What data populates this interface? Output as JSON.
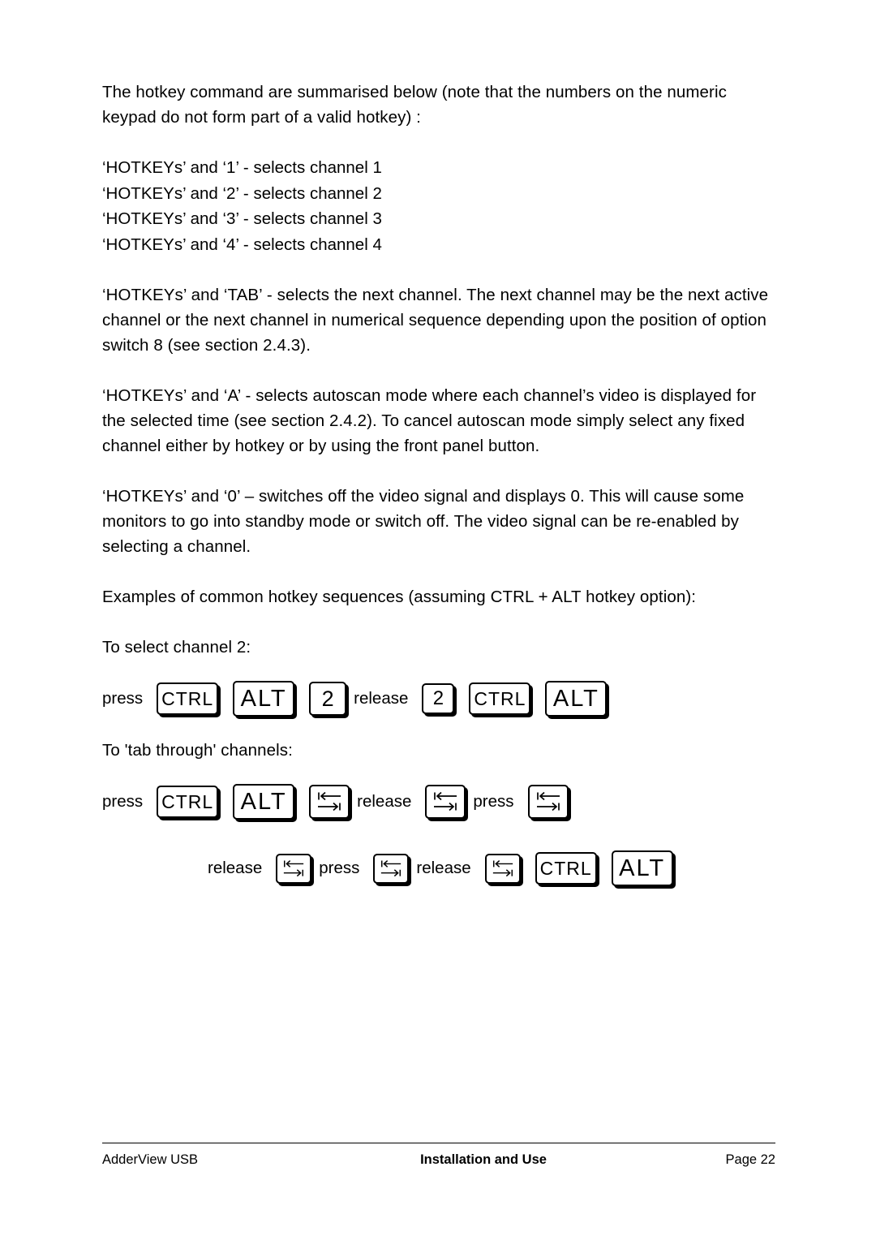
{
  "document": {
    "intro": "The hotkey command are summarised below (note that the numbers on the numeric keypad do not form part of a valid hotkey) :",
    "hotkey_list": [
      "‘HOTKEYs’ and ‘1’ - selects channel 1",
      "‘HOTKEYs’ and ‘2’ - selects channel 2",
      "‘HOTKEYs’ and ‘3’ - selects channel 3",
      "‘HOTKEYs’ and ‘4’ - selects channel 4"
    ],
    "para_tab": "‘HOTKEYs’ and ‘TAB’ - selects the next channel. The next channel may be the next active channel or the next channel in numerical sequence depending upon the position of option switch 8 (see section 2.4.3).",
    "para_autoscan": "‘HOTKEYs’ and ‘A’ - selects autoscan mode where each channel’s video is displayed for the selected time (see section 2.4.2). To cancel autoscan mode simply select any fixed channel either by hotkey or by using the front panel button.",
    "para_zero": "‘HOTKEYs’ and ‘0’ – switches off the video signal and displays 0. This will cause some monitors to go into standby mode or switch off. The video signal can be re-enabled by selecting a channel.",
    "para_examples": "Examples of common hotkey sequences (assuming CTRL + ALT hotkey option):",
    "heading_select_channel": "To select channel 2:",
    "heading_tab_through": "To 'tab through' channels:",
    "sequence_select_channel": [
      {
        "type": "label",
        "text": "press"
      },
      {
        "type": "key",
        "style": "ctrl",
        "label": "CTRL",
        "icon": "ctrl-key"
      },
      {
        "type": "key",
        "style": "alt",
        "label": "ALT",
        "icon": "alt-key"
      },
      {
        "type": "key",
        "style": "num",
        "label": "2",
        "icon": "number-2-key"
      },
      {
        "type": "label",
        "text": "release"
      },
      {
        "type": "key",
        "style": "num-small",
        "label": "2",
        "icon": "number-2-key"
      },
      {
        "type": "key",
        "style": "ctrl",
        "label": "CTRL",
        "icon": "ctrl-key"
      },
      {
        "type": "key",
        "style": "alt",
        "label": "ALT",
        "icon": "alt-key"
      }
    ],
    "sequence_tab_line1": [
      {
        "type": "label",
        "text": "press"
      },
      {
        "type": "key",
        "style": "ctrl",
        "label": "CTRL",
        "icon": "ctrl-key"
      },
      {
        "type": "key",
        "style": "alt",
        "label": "ALT",
        "icon": "alt-key"
      },
      {
        "type": "key",
        "style": "tab",
        "label": "",
        "icon": "tab-key"
      },
      {
        "type": "label",
        "text": "release"
      },
      {
        "type": "key",
        "style": "tab",
        "label": "",
        "icon": "tab-key"
      },
      {
        "type": "label",
        "text": "press"
      },
      {
        "type": "key",
        "style": "tab",
        "label": "",
        "icon": "tab-key"
      }
    ],
    "sequence_tab_line2": [
      {
        "type": "label",
        "text": "release"
      },
      {
        "type": "key",
        "style": "tab-small",
        "label": "",
        "icon": "tab-key"
      },
      {
        "type": "label",
        "text": "press"
      },
      {
        "type": "key",
        "style": "tab-small",
        "label": "",
        "icon": "tab-key"
      },
      {
        "type": "label",
        "text": "release"
      },
      {
        "type": "key",
        "style": "tab-small",
        "label": "",
        "icon": "tab-key"
      },
      {
        "type": "key",
        "style": "ctrl",
        "label": "CTRL",
        "icon": "ctrl-key"
      },
      {
        "type": "key",
        "style": "alt",
        "label": "ALT",
        "icon": "alt-key"
      }
    ]
  },
  "footer": {
    "left": "AdderView USB",
    "center": "Installation and Use",
    "right": "Page 22"
  }
}
